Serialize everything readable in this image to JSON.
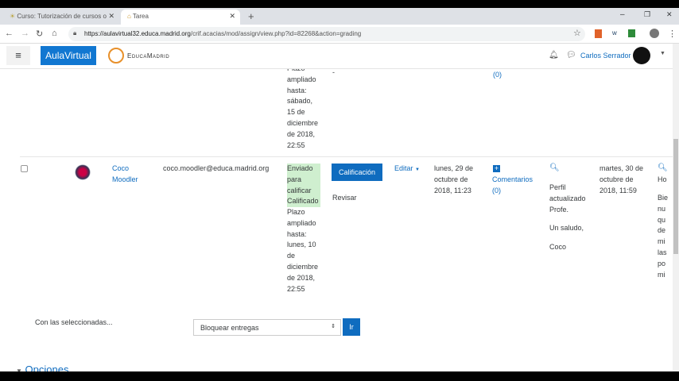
{
  "browser": {
    "tabs": [
      {
        "label": "Curso: Tutorización de cursos o"
      },
      {
        "label": "Tarea"
      }
    ],
    "url_host": "https://aulavirtual32.educa.madrid.org",
    "url_path": "/crif.acacias/mod/assign/view.php?id=82268&action=grading"
  },
  "navbar": {
    "brand": "AulaVirtual",
    "logo_text": "EducaMadrid",
    "user": "Carlos Serrador"
  },
  "prev_row": {
    "status_lines": "Plazo ampliado hasta: sábado, 15 de diciembre de 2018, 22:55",
    "dash": "-",
    "comments_count": "(0)"
  },
  "row": {
    "name": "Coco Moodler",
    "email": "coco.moodler@educa.madrid.org",
    "status_submitted": "Enviado para calificar",
    "status_graded": "Calificado",
    "extension": "Plazo ampliado hasta: lunes, 10 de diciembre de 2018, 22:55",
    "grade_button": "Calificación",
    "review": "Revisar",
    "edit": "Editar",
    "last_modified": "lunes, 29 de octubre de 2018, 11:23",
    "comments": "Comentarios",
    "comments_count": "(0)",
    "feedback": [
      "Perfil actualizado Profe.",
      "Un saludo,",
      "Coco"
    ],
    "graded_date": "martes, 30 de octubre de 2018, 11:59",
    "next_col": "Ho",
    "next_col_lines": [
      "Bie",
      "nu",
      "qu",
      "de",
      "mi",
      "las",
      "po",
      "mi"
    ]
  },
  "bulk": {
    "label": "Con las seleccionadas...",
    "select": "Bloquear entregas",
    "go": "Ir"
  },
  "options": "Opciones"
}
